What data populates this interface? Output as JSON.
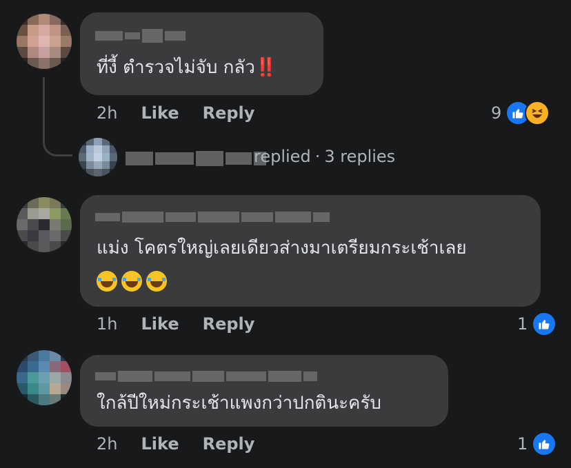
{
  "comments": [
    {
      "text": "ที่งี้ ตำรวจไม่จับ กลัว",
      "emphasis": "‼️",
      "time": "2h",
      "like_label": "Like",
      "reply_label": "Reply",
      "reaction_count": "9",
      "reactions": [
        "like",
        "haha"
      ],
      "reply_summary": {
        "verb": "replied",
        "separator": "·",
        "count_label": "3 replies"
      }
    },
    {
      "text": "แม่ง โคตรใหญ่เลยเดียวส่างมาเตรียมกระเช้าเลย",
      "emojis": [
        "laughing-crying",
        "laughing-crying",
        "laughing-crying"
      ],
      "time": "1h",
      "like_label": "Like",
      "reply_label": "Reply",
      "reaction_count": "1",
      "reactions": [
        "like"
      ]
    },
    {
      "text": "ใกล้ปีใหม่กระเช้าแพงกว่าปกตินะครับ",
      "time": "2h",
      "like_label": "Like",
      "reply_label": "Reply",
      "reaction_count": "1",
      "reactions": [
        "like"
      ]
    }
  ],
  "colors": {
    "background": "#18191a",
    "bubble": "#3a3b3c",
    "text": "#e4e6eb",
    "meta": "#b0b3b8",
    "like_blue": "#1877f2",
    "haha_yellow": "#f7b125"
  }
}
